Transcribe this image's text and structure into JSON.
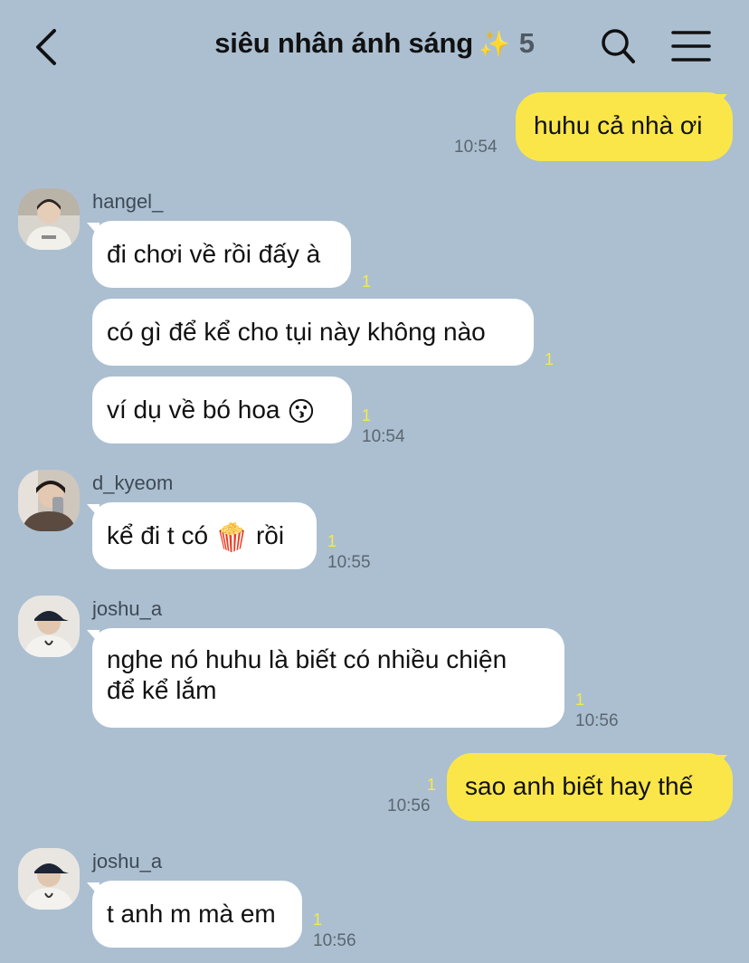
{
  "header": {
    "title": "siêu nhân ánh sáng",
    "sparkle": "✨",
    "member_count": "5"
  },
  "colors": {
    "background": "#abbfd1",
    "my_bubble": "#fbe64a",
    "their_bubble": "#ffffff",
    "unread_count": "#f5e94a"
  },
  "messages": {
    "m1": {
      "text": "huhu cả nhà ơi",
      "time": "10:54"
    },
    "g1": {
      "sender": "hangel_",
      "b1": {
        "text": "đi chơi về rồi đấy à",
        "unread": "1"
      },
      "b2": {
        "text": "có gì để kể cho tụi này không nào",
        "unread": "1"
      },
      "b3": {
        "text": "ví dụ về bó hoa",
        "emoji": "😗",
        "unread": "1"
      },
      "time": "10:54"
    },
    "g2": {
      "sender": "d_kyeom",
      "b1": {
        "text_before": "kể đi t có",
        "emoji": "🍿",
        "text_after": "rồi",
        "unread": "1"
      },
      "time": "10:55"
    },
    "g3": {
      "sender": "joshu_a",
      "b1": {
        "line1": "nghe nó huhu là biết có nhiều chiện",
        "line2": "để kể lắm",
        "unread": "1"
      },
      "time": "10:56"
    },
    "m2": {
      "text": "sao anh biết hay thế",
      "unread": "1",
      "time": "10:56"
    },
    "g4": {
      "sender": "joshu_a",
      "b1": {
        "text": "t anh m mà em",
        "unread": "1"
      },
      "time": "10:56"
    }
  }
}
